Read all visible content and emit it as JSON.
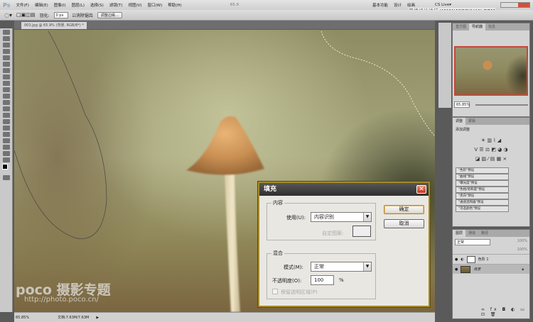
{
  "menubar": {
    "logo": "Ps",
    "items": [
      "文件(F)",
      "编辑(E)",
      "图像(I)",
      "图层(L)",
      "选择(S)",
      "滤镜(T)",
      "视图(V)",
      "窗口(W)",
      "帮助(H)"
    ],
    "zoom": "65.9",
    "workspaces": [
      "基本功能",
      "设计",
      "绘画"
    ],
    "cslive": "CS Live▾",
    "watermark": "思缘设计论坛 WWW.MISSYUAN.COM"
  },
  "options": {
    "feather_label": "羽化:",
    "feather_value": "0 px",
    "antialias_label": "消除锯齿",
    "refine_edge": "调整边缘..."
  },
  "document": {
    "tab": "003.jpg @ 65.9% (背景, RGB/8*) *",
    "watermark_logo": "poco 摄影专题",
    "watermark_url": "http://photo.poco.cn/"
  },
  "status": {
    "zoom": "65.85%",
    "doc": "文档:7.63M/7.63M"
  },
  "navigator": {
    "tabs": [
      "直方图",
      "导航器",
      "信息"
    ],
    "zoom": "65.85%"
  },
  "adjustments": {
    "tabs": [
      "调整",
      "蒙版"
    ],
    "title": "添加调整",
    "presets": [
      "\"色阶\"预设",
      "\"曲线\"预设",
      "\"曝光度\"预设",
      "\"色相/饱和度\"预设",
      "\"黑白\"预设",
      "\"通道混和器\"预设",
      "\"可选颜色\"预设"
    ]
  },
  "layers": {
    "tabs": [
      "图层",
      "通道",
      "路径"
    ],
    "blend": "正常",
    "opacity": "100%",
    "fill": "100%",
    "items": [
      {
        "name": "色阶 1"
      },
      {
        "name": "背景"
      }
    ]
  },
  "dialog": {
    "title": "填充",
    "contents_legend": "内容",
    "use_label": "使用(U):",
    "use_value": "内容识别",
    "custom_pattern": "自定图案:",
    "blend_legend": "混合",
    "mode_label": "模式(M):",
    "mode_value": "正常",
    "opacity_label": "不透明度(O):",
    "opacity_value": "100",
    "percent": "%",
    "preserve": "保留透明区域(P)",
    "ok": "确定",
    "cancel": "取消"
  }
}
